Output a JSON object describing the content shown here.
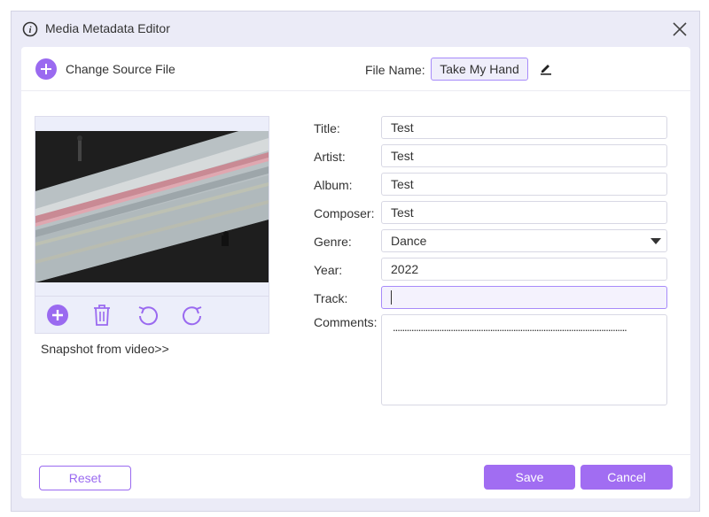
{
  "window": {
    "title": "Media Metadata Editor"
  },
  "topbar": {
    "change_source_label": "Change Source File",
    "file_name_label": "File Name:",
    "file_name_value": "Take My Hand"
  },
  "cover": {
    "snapshot_label": "Snapshot from video>>"
  },
  "fields": {
    "title_label": "Title:",
    "title_value": "Test",
    "artist_label": "Artist:",
    "artist_value": "Test",
    "album_label": "Album:",
    "album_value": "Test",
    "composer_label": "Composer:",
    "composer_value": "Test",
    "genre_label": "Genre:",
    "genre_value": "Dance",
    "year_label": "Year:",
    "year_value": "2022",
    "track_label": "Track:",
    "track_value": "",
    "comments_label": "Comments:",
    "comments_value": "....................................................................................................."
  },
  "footer": {
    "reset_label": "Reset",
    "save_label": "Save",
    "cancel_label": "Cancel"
  },
  "icons": {
    "info": "info-icon",
    "close": "close-icon",
    "add": "plus-circle-icon",
    "edit": "pencil-icon",
    "delete": "trash-icon",
    "rotate_left": "rotate-left-icon",
    "rotate_right": "rotate-right-icon",
    "dropdown": "chevron-down-icon"
  },
  "colors": {
    "accent": "#a16df2",
    "window_bg": "#ebebf7",
    "cover_bg": "#eceefa"
  }
}
